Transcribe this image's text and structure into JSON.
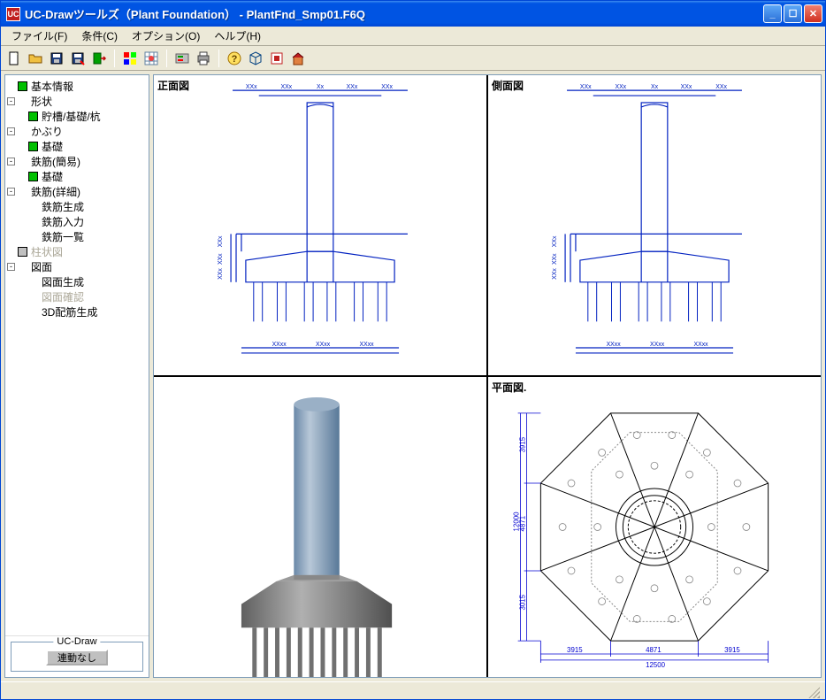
{
  "window": {
    "title": "UC-Drawツールズ（Plant Foundation） - PlantFnd_Smp01.F6Q"
  },
  "menu": {
    "file": "ファイル(F)",
    "conditions": "条件(C)",
    "options": "オプション(O)",
    "help": "ヘルプ(H)"
  },
  "toolbar_icons": {
    "new": "new",
    "open": "open",
    "save": "save",
    "save_as": "save-as",
    "exit": "exit",
    "color": "color",
    "grid": "grid",
    "settings": "settings",
    "print": "print",
    "help": "help",
    "view3d": "view3d",
    "plan": "plan",
    "help2": "help2"
  },
  "tree": {
    "items": [
      {
        "depth": 0,
        "toggle": "",
        "box": "green",
        "label": "基本情報",
        "disabled": false
      },
      {
        "depth": 0,
        "toggle": "-",
        "box": "",
        "label": "形状",
        "disabled": false
      },
      {
        "depth": 1,
        "toggle": "",
        "box": "green",
        "label": "貯槽/基礎/杭",
        "disabled": false
      },
      {
        "depth": 0,
        "toggle": "-",
        "box": "",
        "label": "かぶり",
        "disabled": false
      },
      {
        "depth": 1,
        "toggle": "",
        "box": "green",
        "label": "基礎",
        "disabled": false
      },
      {
        "depth": 0,
        "toggle": "-",
        "box": "",
        "label": "鉄筋(簡易)",
        "disabled": false
      },
      {
        "depth": 1,
        "toggle": "",
        "box": "green",
        "label": "基礎",
        "disabled": false
      },
      {
        "depth": 0,
        "toggle": "-",
        "box": "",
        "label": "鉄筋(詳細)",
        "disabled": false
      },
      {
        "depth": 1,
        "toggle": "",
        "box": "",
        "label": "鉄筋生成",
        "disabled": false
      },
      {
        "depth": 1,
        "toggle": "",
        "box": "",
        "label": "鉄筋入力",
        "disabled": false
      },
      {
        "depth": 1,
        "toggle": "",
        "box": "",
        "label": "鉄筋一覧",
        "disabled": false
      },
      {
        "depth": 0,
        "toggle": "",
        "box": "gray",
        "label": "柱状図",
        "disabled": true
      },
      {
        "depth": 0,
        "toggle": "-",
        "box": "",
        "label": "図面",
        "disabled": false
      },
      {
        "depth": 1,
        "toggle": "",
        "box": "",
        "label": "図面生成",
        "disabled": false
      },
      {
        "depth": 1,
        "toggle": "",
        "box": "",
        "label": "図面確認",
        "disabled": true
      },
      {
        "depth": 1,
        "toggle": "",
        "box": "",
        "label": "3D配筋生成",
        "disabled": false
      }
    ]
  },
  "sidebar_footer": {
    "group_label": "UC-Draw",
    "button": "連動なし"
  },
  "views": {
    "front": "正面図",
    "side": "側面図",
    "plan": "平面図."
  },
  "chart_data": {
    "type": "engineering-drawing",
    "views": {
      "front": {
        "top_dims": [
          "XXx",
          "XXx",
          "Xx",
          "XXx",
          "XXx"
        ],
        "v_dims": [
          "XXx",
          "XXx",
          "XXx"
        ],
        "bottom_dims": [
          "XXxx",
          "XXxx",
          "XXxx"
        ]
      },
      "side": {
        "top_dims": [
          "XXx",
          "XXx",
          "Xx",
          "XXx",
          "XXx"
        ],
        "v_dims": [
          "XXx",
          "XXx",
          "XXx"
        ],
        "bottom_dims": [
          "XXxx",
          "XXxx",
          "XXxx"
        ]
      },
      "plan": {
        "h_dims_bottom": [
          "3915",
          "4871",
          "3915",
          "12500"
        ],
        "v_dims_left": [
          "3915",
          "4871",
          "3015",
          "12000"
        ]
      }
    }
  }
}
